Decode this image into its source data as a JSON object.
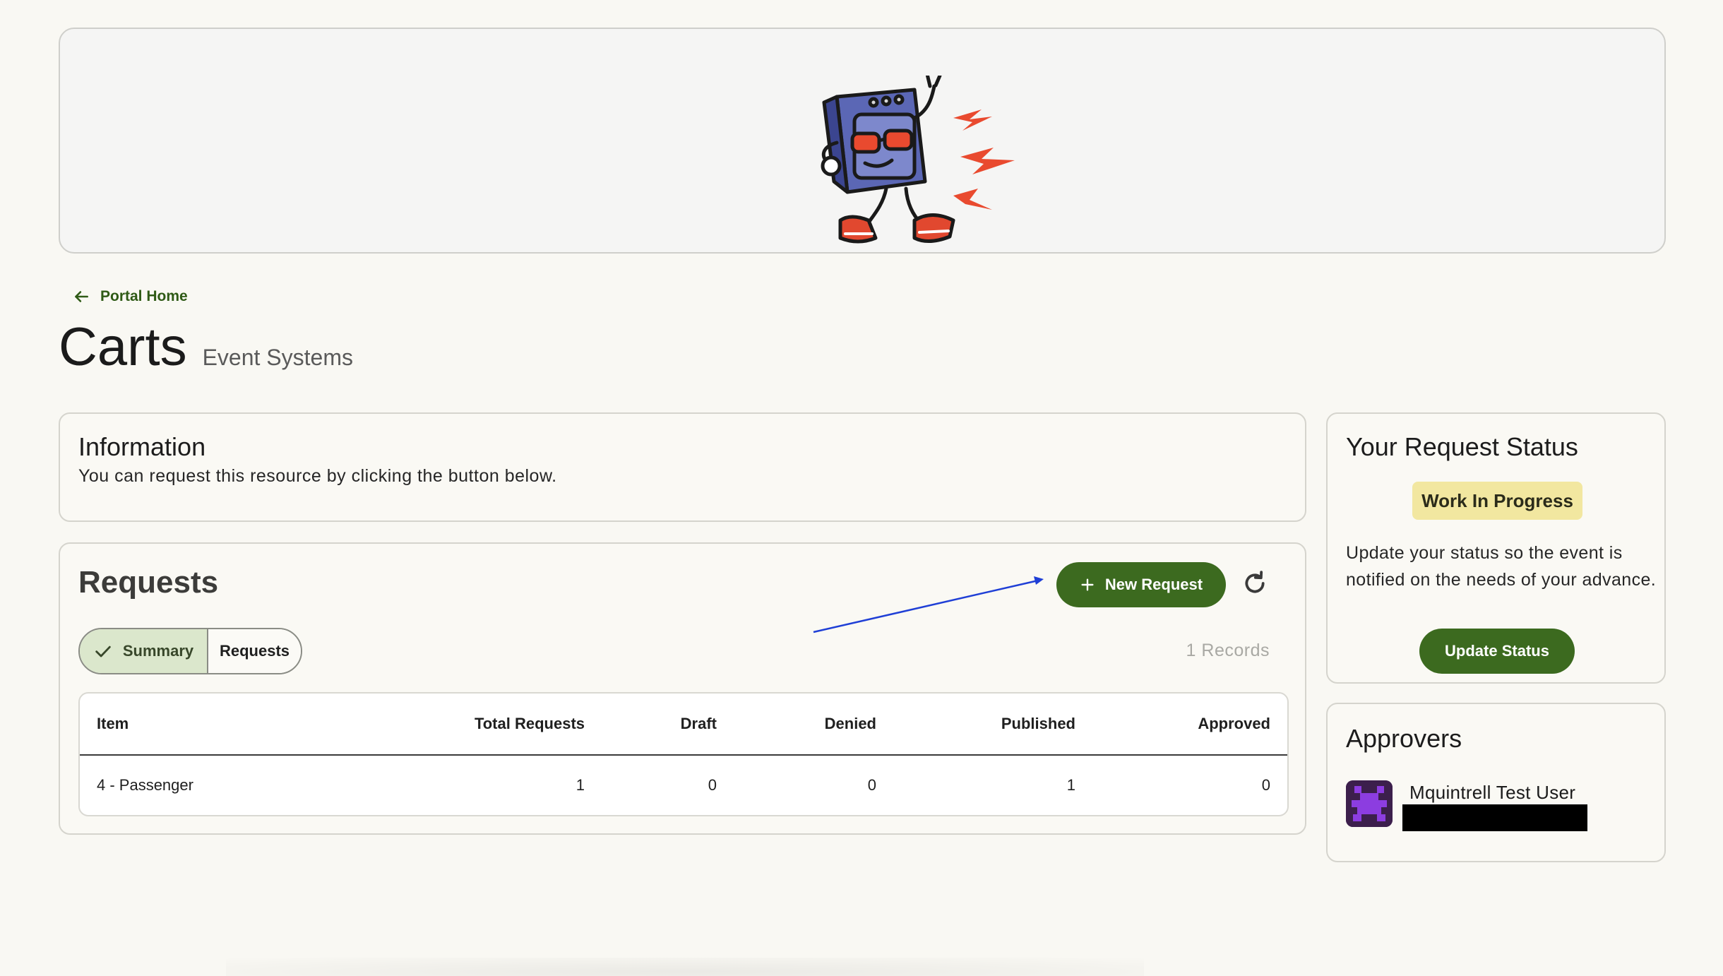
{
  "nav": {
    "back_label": "Portal Home"
  },
  "page": {
    "title": "Carts",
    "subtitle": "Event Systems"
  },
  "information": {
    "heading": "Information",
    "text": "You can request this resource by clicking the button below."
  },
  "requests": {
    "heading": "Requests",
    "new_request_label": "New Request",
    "segments": [
      {
        "label": "Summary",
        "selected": true
      },
      {
        "label": "Requests",
        "selected": false
      }
    ],
    "records_label": "1 Records",
    "table": {
      "columns": [
        "Item",
        "Total Requests",
        "Draft",
        "Denied",
        "Published",
        "Approved"
      ],
      "rows": [
        [
          "4 - Passenger",
          "1",
          "0",
          "0",
          "1",
          "0"
        ]
      ]
    }
  },
  "status": {
    "heading": "Your Request Status",
    "badge": "Work In Progress",
    "description": "Update your status so the event is notified on the needs of your advance.",
    "button_label": "Update Status"
  },
  "approvers": {
    "heading": "Approvers",
    "items": [
      {
        "name": "Mquintrell Test User"
      }
    ]
  },
  "colors": {
    "primary": "#3c6a1f",
    "background": "#f9f8f3",
    "badge": "#f2e7a0",
    "segment_selected": "#dbe7cc",
    "annotation_arrow": "#1f3fd6"
  },
  "icons": [
    "mascot-logo",
    "arrow-left-icon",
    "check-icon",
    "plus-icon",
    "refresh-icon",
    "avatar-icon"
  ]
}
